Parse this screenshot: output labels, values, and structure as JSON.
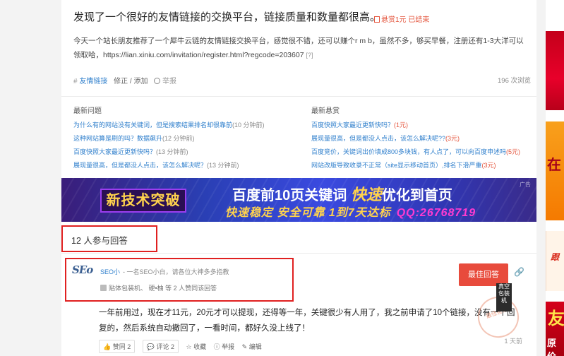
{
  "question": {
    "title": "发现了一个很好的友情链接的交换平台，链接质量和数量都很高。",
    "bounty": "悬赏1元 已结束",
    "body": "今天一个站长朋友推荐了一个犀牛云链的友情链接交换平台，感觉很不错，还可以赚个r m b，虽然不多，够买早餐，注册还有1-3大洋可以领取哈，https://lian.xiniu.com/invitation/register.html?regcode=203607",
    "body_qmark": "[?]",
    "tag_hash": "#",
    "tag": "友情链接",
    "edit_label": "修正 / 添加",
    "report_label": "举报",
    "views": "196 次浏览"
  },
  "latest": {
    "heading": "最新问题",
    "items": [
      {
        "text": "为什么有的网站没有关键词，但是搜索结果排名却很靠前",
        "meta": "(10 分钟前)"
      },
      {
        "text": "这种网站算是刷的吗？数据飙升",
        "meta": "(12 分钟前)"
      },
      {
        "text": "百度快照大家最近更新快吗？",
        "meta": "(13 分钟前)"
      },
      {
        "text": "展现量很高，但是都没人点击，该怎么解决呢？",
        "meta": "(13 分钟前)"
      }
    ]
  },
  "bounties": {
    "heading": "最新悬赏",
    "items": [
      {
        "text": "百度快照大家最近更新快吗？",
        "reward": "(1元)"
      },
      {
        "text": "展现量很高，但是都没人点击，该怎么解决呢??",
        "reward": "(3元)"
      },
      {
        "text": "百度竞价，关键词出价填成800多块钱，有人点了，可以向百度申述吗",
        "reward": "(5元)"
      },
      {
        "text": "网站改版导致收录不正常（site显示移动首页）,排名下滑严重",
        "reward": "(3元)"
      }
    ]
  },
  "banner": {
    "left": "新技术突破",
    "main_a": "百度前10页关键词",
    "main_fast": "快速",
    "main_b": "优化到首页",
    "sub": "快速稳定 安全可靠 1到7天达标",
    "qq": "QQ:26768719",
    "tag": "广告"
  },
  "answers": {
    "count_label": "12 人参与回答"
  },
  "answer": {
    "avatar": "SEo",
    "user": "SEO小",
    "signature": "- 一名SEO小白，请各位大神多多指教",
    "likes": "贴体包装机、 硬•柚 等 2 人赞同该回答",
    "best_label": "最佳回答",
    "link_icon": "link-icon",
    "body": "一年前用过，现在才11元，20元才可以提现，还得等一年，关键很少有人用了，我之前申请了10个链接，没有一个回复的，然后系统自动撤回了，一看时间，都好久没上线了！",
    "stamp": "最佳答案",
    "time": "1 天前",
    "vote": "赞同 2",
    "comments": "评论 2",
    "favorite": "收藏",
    "report": "举报",
    "edit": "编辑"
  },
  "tooltip": "真空包装机",
  "ads": {
    "ad2": "在",
    "ad3": "跟",
    "ad4_a": "友",
    "ad4_b": "原价"
  }
}
